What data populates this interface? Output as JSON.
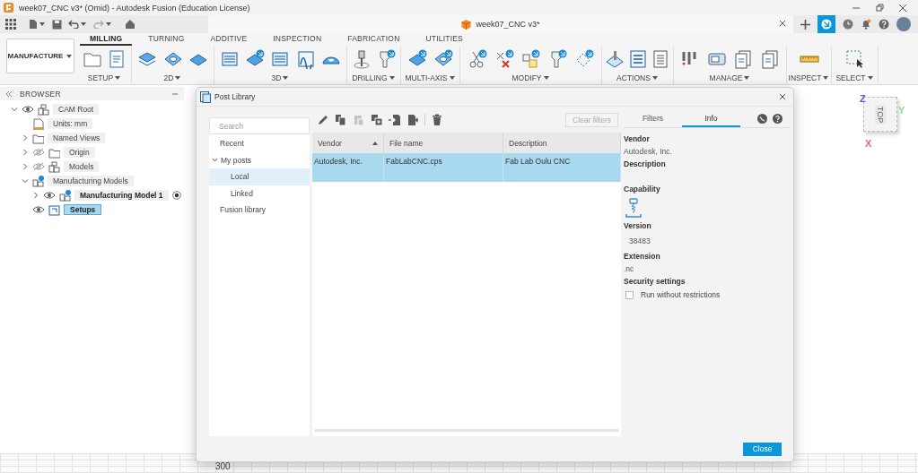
{
  "window": {
    "title": "week07_CNC v3* (Omid) - Autodesk Fusion (Education License)"
  },
  "document_tab": {
    "title": "week07_CNC v3*"
  },
  "ribbon": {
    "workspace": "MANUFACTURE",
    "tabs": [
      {
        "label": "MILLING",
        "selected": true
      },
      {
        "label": "TURNING",
        "selected": false
      },
      {
        "label": "ADDITIVE",
        "selected": false
      },
      {
        "label": "INSPECTION",
        "selected": false
      },
      {
        "label": "FABRICATION",
        "selected": false
      },
      {
        "label": "UTILITIES",
        "selected": false
      }
    ],
    "groups": [
      {
        "label": "SETUP"
      },
      {
        "label": "2D"
      },
      {
        "label": "3D"
      },
      {
        "label": "DRILLING"
      },
      {
        "label": "MULTI-AXIS"
      },
      {
        "label": "MODIFY"
      },
      {
        "label": "ACTIONS"
      },
      {
        "label": "MANAGE"
      },
      {
        "label": "INSPECT"
      },
      {
        "label": "SELECT"
      }
    ]
  },
  "browser": {
    "title": "BROWSER",
    "tree": [
      {
        "label": "CAM Root",
        "kind": "component",
        "expanded": true,
        "visible": true,
        "selected": false,
        "active": false,
        "children": [
          {
            "label": "Units: mm",
            "kind": "units",
            "selected": false,
            "active": false
          },
          {
            "label": "Named Views",
            "kind": "folder",
            "expanded": false,
            "selected": false,
            "active": false
          },
          {
            "label": "Origin",
            "kind": "folder",
            "expanded": false,
            "visible": false,
            "selected": false,
            "active": false
          },
          {
            "label": "Models",
            "kind": "component",
            "expanded": false,
            "visible": false,
            "selected": false,
            "active": false
          },
          {
            "label": "Manufacturing Models",
            "kind": "model",
            "expanded": true,
            "selected": false,
            "active": false,
            "children": [
              {
                "label": "Manufacturing Model 1",
                "kind": "model",
                "expanded": false,
                "visible": true,
                "selected": false,
                "active": true
              }
            ]
          },
          {
            "label": "Setups",
            "kind": "setups",
            "visible": true,
            "selected": true,
            "active": false
          }
        ]
      }
    ]
  },
  "dialog": {
    "title": "Post Library",
    "search": {
      "placeholder": "Search"
    },
    "nav": [
      {
        "label": "Recent",
        "selected": false
      },
      {
        "label": "My posts",
        "selected": false,
        "expanded": true,
        "children": [
          {
            "label": "Local",
            "selected": true
          },
          {
            "label": "Linked",
            "selected": false
          }
        ]
      },
      {
        "label": "Fusion library",
        "selected": false
      }
    ],
    "toolbar": [
      {
        "kind": "edit",
        "disabled": false
      },
      {
        "kind": "copy",
        "disabled": false
      },
      {
        "kind": "paste",
        "disabled": true
      },
      {
        "kind": "duplicate",
        "disabled": false
      },
      {
        "kind": "import",
        "disabled": false
      },
      {
        "kind": "export",
        "disabled": false
      },
      {
        "kind": "delete",
        "disabled": false
      }
    ],
    "clear_filters": {
      "label": "Clear filters",
      "disabled": true
    },
    "table": {
      "columns": [
        {
          "label": "Vendor",
          "sorted": true
        },
        {
          "label": "File name",
          "sorted": false
        },
        {
          "label": "Description",
          "sorted": false
        }
      ],
      "rows": [
        {
          "selected": true,
          "cells": [
            "Autodesk, Inc.",
            "FabLabCNC.cps",
            "Fab Lab Oulu CNC"
          ]
        }
      ]
    },
    "panel_tabs": [
      {
        "label": "Filters",
        "selected": false
      },
      {
        "label": "Info",
        "selected": true
      }
    ],
    "info": [
      {
        "label": "Vendor",
        "kind": "text",
        "value": "Autodesk, Inc."
      },
      {
        "label": "Description",
        "kind": "empty"
      },
      {
        "label": "Capability",
        "kind": "icon"
      },
      {
        "label": "Version",
        "kind": "number",
        "value": "38483"
      },
      {
        "label": "Extension",
        "kind": "text",
        "value": ".nc"
      },
      {
        "label": "Security settings",
        "kind": "checkbox",
        "option": "Run without restrictions",
        "checked": false
      }
    ],
    "close_button": "Close"
  },
  "viewcube": {
    "face": "TOP",
    "axes": [
      {
        "label": "Z",
        "color": "#5b5bd0"
      },
      {
        "label": "Y",
        "color": "#8ad88a"
      },
      {
        "label": "X",
        "color": "#e06a6a"
      }
    ]
  },
  "grid": {
    "label": "300"
  }
}
